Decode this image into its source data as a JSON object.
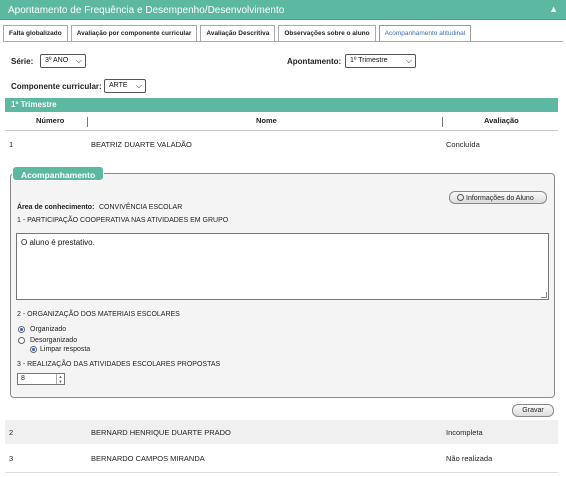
{
  "header": {
    "title": "Apontamento de Frequência e Desempenho/Desenvolvimento",
    "collapse_icon": "▲"
  },
  "tabs": [
    {
      "label": "Falta globalizado"
    },
    {
      "label": "Avaliação por componente curricular"
    },
    {
      "label": "Avaliação Descritiva"
    },
    {
      "label": "Observações sobre o aluno"
    },
    {
      "label": "Acompanhamento atitudinal",
      "active": true
    }
  ],
  "filters": {
    "serie_label": "Série:",
    "serie_value": "3º ANO",
    "apontamento_label": "Apontamento:",
    "apontamento_value": "1º Trimestre",
    "componente_label": "Componente curricular:",
    "componente_value": "ARTE"
  },
  "section_title": "1º Trimestre",
  "table": {
    "columns": [
      "Número",
      "Nome",
      "Avaliação"
    ],
    "rows": [
      {
        "numero": "1",
        "nome": "BEATRIZ DUARTE VALADÃO",
        "avaliacao": "Concluída"
      },
      {
        "numero": "2",
        "nome": "BERNARD HENRIQUE DUARTE PRADO",
        "avaliacao": "Incompleta"
      },
      {
        "numero": "3",
        "nome": "BERNARDO CAMPOS MIRANDA",
        "avaliacao": "Não realizada"
      }
    ]
  },
  "acompanhamento": {
    "title": "Acompanhamento",
    "info_button": "Informações do Aluno",
    "area_label": "Área de conhecimento:",
    "area_value": "CONVIVÊNCIA ESCOLAR",
    "q1": "1 - PARTICIPAÇÃO COOPERATIVA NAS ATIVIDADES EM GRUPO",
    "q1_answer": "O aluno é prestativo.",
    "q2": "2 - ORGANIZAÇÃO DOS MATERIAIS ESCOLARES",
    "q2_options": [
      "Organizado",
      "Desorganizado"
    ],
    "q2_selected": "Organizado",
    "clear_label": "Limpar resposta",
    "q3": "3 - REALIZAÇÃO DAS ATIVIDADES ESCOLARES PROPOSTAS",
    "q3_value": "8"
  },
  "save_button": "Gravar",
  "colors": {
    "accent": "#5cb8a0",
    "radio": "#2a62c9"
  }
}
